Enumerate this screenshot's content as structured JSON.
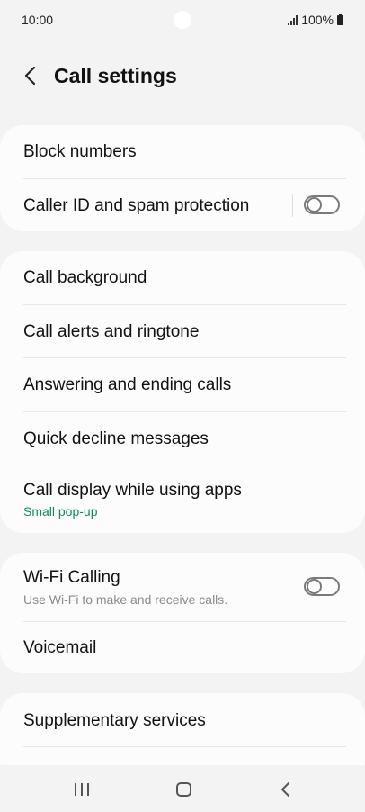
{
  "status": {
    "time": "10:00",
    "battery": "100%"
  },
  "header": {
    "title": "Call settings"
  },
  "group1": {
    "block_numbers": "Block numbers",
    "caller_id": "Caller ID and spam protection",
    "caller_id_on": false
  },
  "group2": {
    "call_background": "Call background",
    "call_alerts": "Call alerts and ringtone",
    "answering": "Answering and ending calls",
    "quick_decline": "Quick decline messages",
    "call_display": "Call display while using apps",
    "call_display_value": "Small pop-up"
  },
  "group3": {
    "wifi_calling": "Wi-Fi Calling",
    "wifi_calling_desc": "Use Wi-Fi to make and receive calls.",
    "wifi_calling_on": false,
    "voicemail": "Voicemail"
  },
  "group4": {
    "supplementary": "Supplementary services"
  },
  "colors": {
    "accent_green": "#0f8a5f",
    "background": "#f3f3f3",
    "card": "#fcfcfc"
  }
}
